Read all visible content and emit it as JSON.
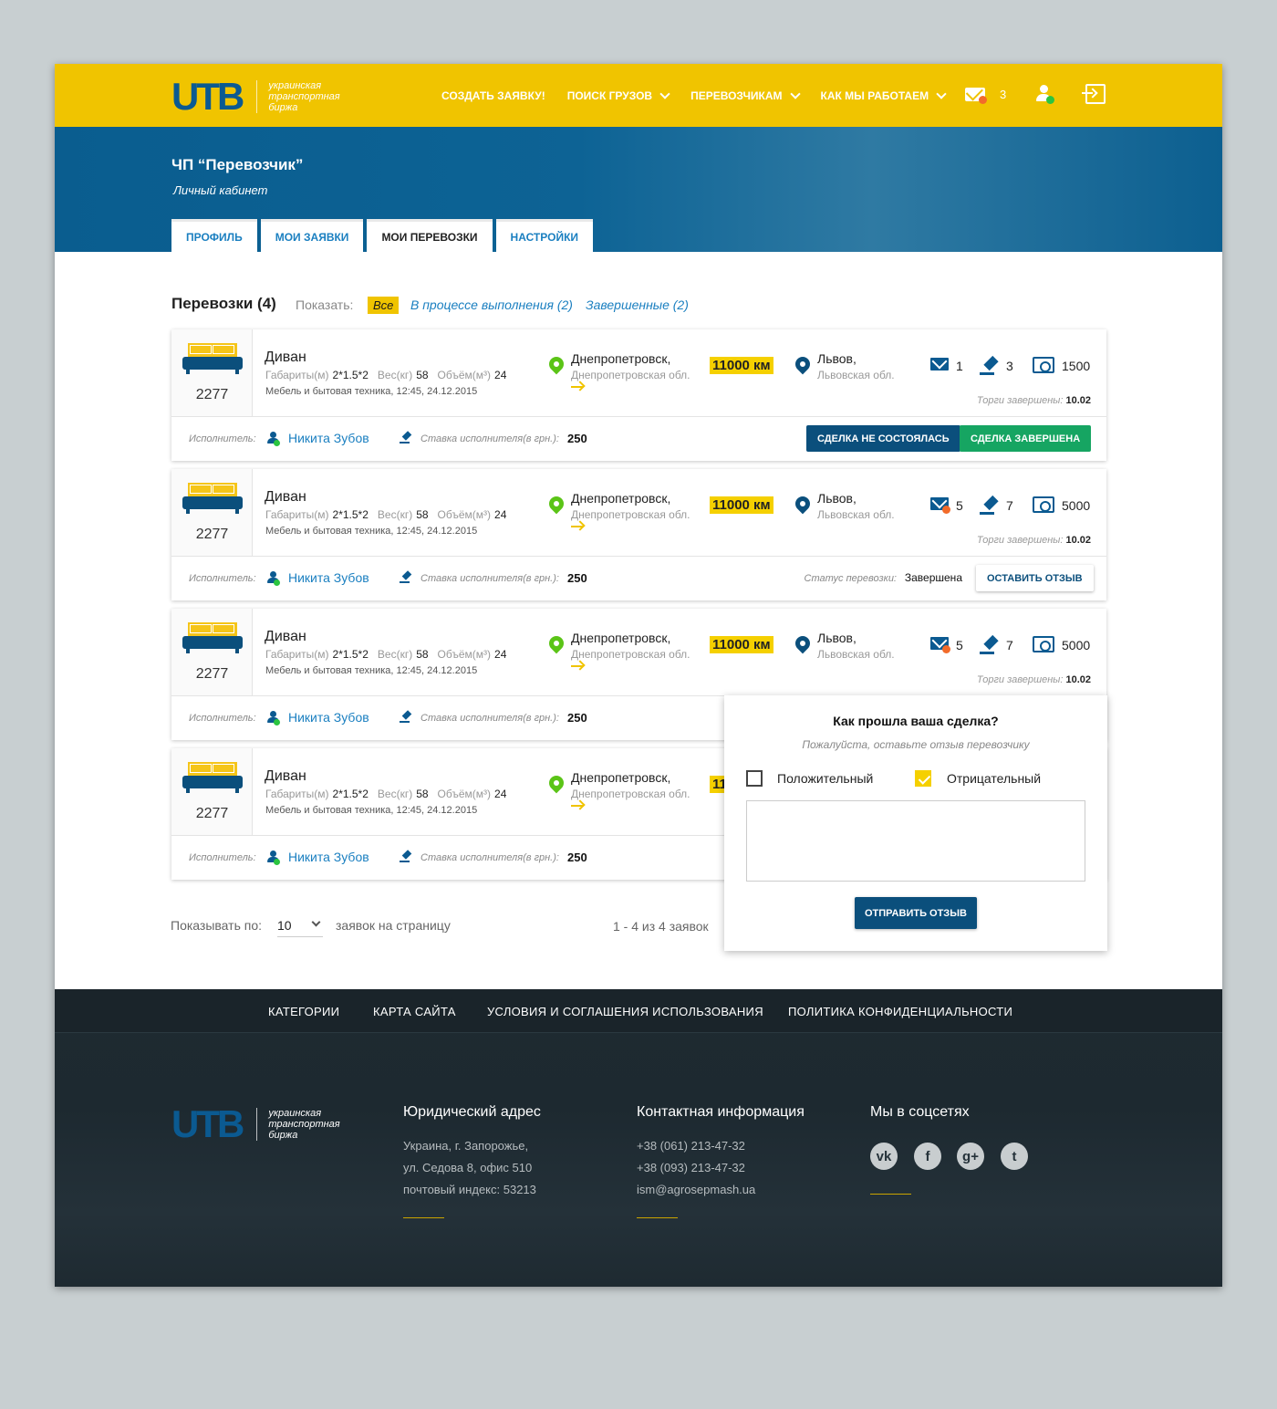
{
  "header": {
    "logo_letters": "UTB",
    "logo_text": "украинская транспортная биржа",
    "nav": [
      "СОЗДАТЬ ЗАЯВКУ!",
      "ПОИСК ГРУЗОВ",
      "ПЕРЕВОЗЧИКАМ",
      "КАК МЫ РАБОТАЕМ"
    ],
    "mail_count": "3",
    "icons": [
      "mail-icon",
      "user-icon",
      "logout-icon"
    ],
    "colors": {
      "brand_yellow": "#f0c400",
      "brand_blue": "#0b5a91",
      "notify_orange": "#f26b2a",
      "online_green": "#2bc440"
    }
  },
  "hero": {
    "company": "ЧП “Перевозчик”",
    "subtitle": "Личный кабинет",
    "tabs": [
      "ПРОФИЛЬ",
      "МОИ ЗАЯВКИ",
      "МОИ ПЕРЕВОЗКИ",
      "НАСТРОЙКИ"
    ],
    "active_tab": "МОИ ПЕРЕВОЗКИ"
  },
  "section": {
    "title": "Перевозки (4)",
    "show_label": "Показать:",
    "filters": [
      "Все",
      "В процессе выполнения (2)",
      "Завершенные (2)"
    ]
  },
  "labels": {
    "dims": "Габариты(м)",
    "weight": "Вес(кг)",
    "volume": "Объём(м³)",
    "bids_end": "Торги завершены:",
    "executor": "Исполнитель:",
    "rate": "Ставка исполнителя(в грн.):",
    "status": "Статус перевозки:"
  },
  "cards": [
    {
      "id": "2277",
      "name": "Диван",
      "dims": "2*1.5*2",
      "weight": "58",
      "volume": "24",
      "category": "Мебель и бытовая техника",
      "datetime": ", 12:45, 24.12.2015",
      "from_city": "Днепропетровск,",
      "from_region": "Днепропетровская обл.",
      "distance": "11000 км",
      "to_city": "Львов,",
      "to_region": "Львовская обл.",
      "messages": "1",
      "bids": "3",
      "price": "1500",
      "bids_end_date": "10.02",
      "executor": "Никита Зубов",
      "rate": "250",
      "btn1": "СДЕЛКА НЕ СОСТОЯЛАСЬ",
      "btn2": "СДЕЛКА ЗАВЕРШЕНА"
    },
    {
      "id": "2277",
      "name": "Диван",
      "dims": "2*1.5*2",
      "weight": "58",
      "volume": "24",
      "category": "Мебель и бытовая техника",
      "datetime": ", 12:45, 24.12.2015",
      "from_city": "Днепропетровск,",
      "from_region": "Днепропетровская обл.",
      "distance": "11000 км",
      "to_city": "Львов,",
      "to_region": "Львовская обл.",
      "messages": "5",
      "bids": "7",
      "price": "5000",
      "bids_end_date": "10.02",
      "executor": "Никита Зубов",
      "rate": "250",
      "status": "Завершена",
      "btn": "ОСТАВИТЬ ОТЗЫВ"
    },
    {
      "id": "2277",
      "name": "Диван",
      "dims": "2*1.5*2",
      "weight": "58",
      "volume": "24",
      "category": "Мебель и бытовая техника",
      "datetime": ", 12:45, 24.12.2015",
      "from_city": "Днепропетровск,",
      "from_region": "Днепропетровская обл.",
      "distance": "11000 км",
      "to_city": "Львов,",
      "to_region": "Львовская обл.",
      "messages": "5",
      "bids": "7",
      "price": "5000",
      "bids_end_date": "10.02",
      "executor": "Никита Зубов",
      "rate": "250"
    },
    {
      "id": "2277",
      "name": "Диван",
      "dims": "2*1.5*2",
      "weight": "58",
      "volume": "24",
      "category": "Мебель и бытовая техника",
      "datetime": ", 12:45, 24.12.2015",
      "from_city": "Днепропетровск,",
      "from_region": "Днепропетровская обл.",
      "distance": "11",
      "executor": "Никита Зубов",
      "rate": "250"
    }
  ],
  "pager": {
    "label": "Показывать по:",
    "per_page": "10",
    "suffix": "заявок на страницу",
    "count": "1 - 4 из 4 заявок"
  },
  "popup": {
    "title": "Как прошла ваша сделка?",
    "subtitle": "Пожалуйста, оставьте отзыв перевозчику",
    "positive": "Положительный",
    "negative": "Отрицательный",
    "positive_checked": false,
    "negative_checked": true,
    "textarea_value": "",
    "submit": "ОТПРАВИТЬ ОТЗЫВ"
  },
  "footer": {
    "nav": [
      "КАТЕГОРИИ",
      "КАРТА САЙТА",
      "УСЛОВИЯ И СОГЛАШЕНИЯ ИСПОЛЬЗОВАНИЯ",
      "ПОЛИТИКА КОНФИДЕНЦИАЛЬНОСТИ"
    ],
    "logo_letters": "UTB",
    "logo_text": "украинская транспортная биржа",
    "address_title": "Юридический  адрес",
    "address_lines": [
      "Украина, г. Запорожье,",
      "ул. Седова 8, офис 510",
      "почтовый индекс: 53213"
    ],
    "contact_title": "Контактная информация",
    "contact_lines": [
      "+38 (061) 213-47-32",
      "+38 (093) 213-47-32",
      "ism@agrosepmash.ua"
    ],
    "social_title": "Мы в соцсетях",
    "social": [
      {
        "icon": "vk-icon",
        "glyph": "vk"
      },
      {
        "icon": "facebook-icon",
        "glyph": "f"
      },
      {
        "icon": "google-plus-icon",
        "glyph": "g+"
      },
      {
        "icon": "twitter-icon",
        "glyph": "t"
      }
    ]
  }
}
